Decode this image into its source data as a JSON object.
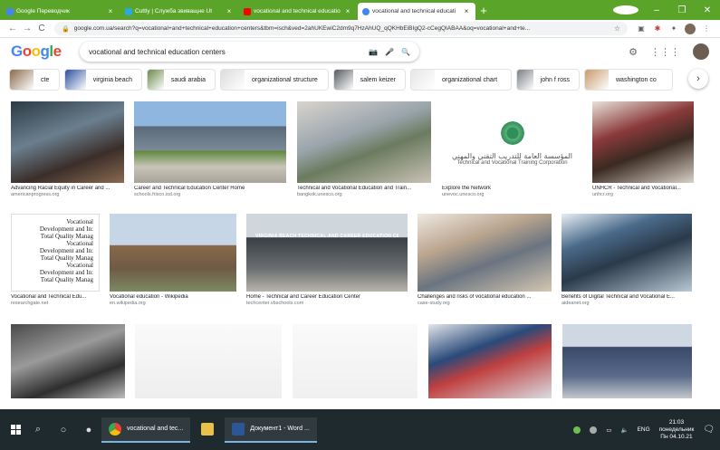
{
  "tabs": [
    {
      "title": "Google Переводчик",
      "favicon_color": "#4285f4"
    },
    {
      "title": "Cuttly | Служба звиващне Ut",
      "favicon_color": "#2aa8e0"
    },
    {
      "title": "vocational and technical educatio",
      "favicon_color": "#ff0000"
    },
    {
      "title": "vocational and technical educati",
      "favicon_color": "#4285f4",
      "active": true
    }
  ],
  "new_tab_label": "+",
  "window_controls": {
    "minimize": "–",
    "maximize": "❐",
    "close": "✕"
  },
  "toolbar": {
    "back": "←",
    "forward": "→",
    "reload": "C",
    "url": "google.com.ua/search?q=vocational+and+technical+education+centers&tbm=isch&ved=2ahUKEwiC2dm9q7HzAhUQ_qQKHbEiBIgQ2-cCegQIABAA&oq=vocational+and+te..."
  },
  "google": {
    "logo": [
      "G",
      "o",
      "o",
      "g",
      "l",
      "e"
    ],
    "logo_colors": [
      "#4285f4",
      "#ea4335",
      "#fbbc05",
      "#4285f4",
      "#34a853",
      "#ea4335"
    ],
    "query": "vocational and technical education centers"
  },
  "chips": [
    {
      "label": "cte",
      "color": "#8a6a4a"
    },
    {
      "label": "virginia beach",
      "color": "#2b4f9e"
    },
    {
      "label": "saudi arabia",
      "color": "#6a8a4a"
    },
    {
      "label": "organizational structure",
      "color": "#dcdcdc"
    },
    {
      "label": "salem keizer",
      "color": "#555a60"
    },
    {
      "label": "organizational chart",
      "color": "#e6e6e6"
    },
    {
      "label": "john f ross",
      "color": "#7a7f85"
    },
    {
      "label": "washington co",
      "color": "#c89a6a"
    }
  ],
  "chip_next": "›",
  "results": [
    {
      "caption": "Advancing Racial Equity in Career and ...",
      "source": "americanprogress.org"
    },
    {
      "caption": "Career and Technical Education Center Home",
      "source": "schools.frisco.isd.org"
    },
    {
      "caption": "Technical and Vocational Education and Train...",
      "source": "bangkok.unesco.org"
    },
    {
      "caption": "Explore the Network",
      "source": "unevoc.unesco.org",
      "logo_arabic": "المؤسسة العامة للتدريب التقني والمهني",
      "logo_english": "Technical and Vocational Training Corporation"
    },
    {
      "caption": "UNHCR - Technical and Vocational...",
      "source": "unhcr.org"
    },
    {
      "caption": "Vocational and Technical Edu...",
      "source": "researchgate.net",
      "doc_lines": [
        "Vocational",
        "Development and In:",
        "Total Quality Manag",
        "Vocational",
        "Development and In:",
        "Total Quality Manag",
        "Vocational",
        "Development and In:",
        "Total Quality Manag"
      ]
    },
    {
      "caption": "Vocational education - Wikipedia",
      "source": "en.wikipedia.org"
    },
    {
      "caption": "Home - Technical and Career Education Center",
      "source": "techcenter.vbschools.com",
      "sign": "VIRGINIA BEACH TECHNICAL AND CAREER EDUCATION CENTER"
    },
    {
      "caption": "Challenges and risks of vocational education ...",
      "source": "case-study.org"
    },
    {
      "caption": "Benefits of Digital Technical and Vocational E...",
      "source": "aideanet.org"
    },
    {
      "caption": "",
      "source": ""
    },
    {
      "caption": "",
      "source": ""
    },
    {
      "caption": "",
      "source": ""
    },
    {
      "caption": "",
      "source": ""
    },
    {
      "caption": "",
      "source": ""
    }
  ],
  "taskbar": {
    "apps": [
      {
        "label": "vocational and tec...",
        "color": "#4285f4"
      },
      {
        "label": "",
        "color": "#e8c04a"
      },
      {
        "label": "Документ1 - Word ...",
        "color": "#2b5797"
      }
    ],
    "lang": "ENG",
    "time": "21:03",
    "day": "понедельник",
    "date": "Пн 04.10.21"
  }
}
